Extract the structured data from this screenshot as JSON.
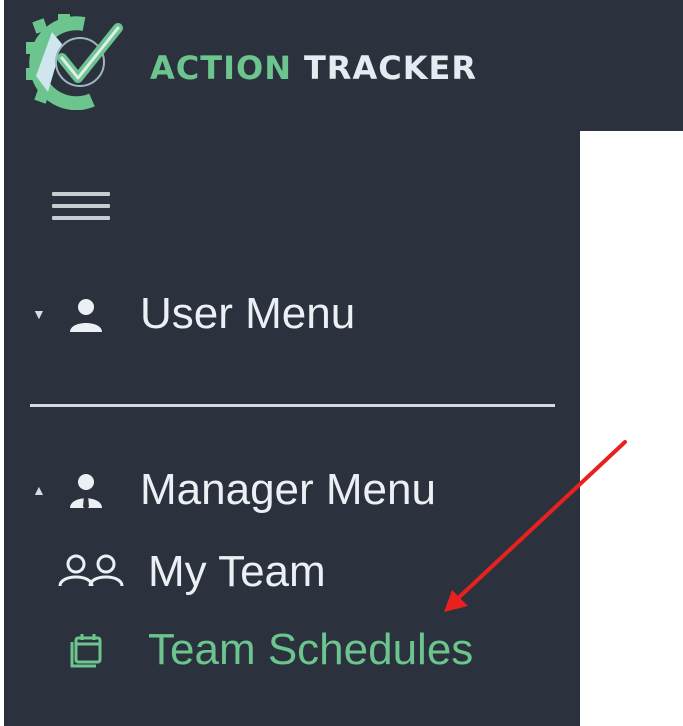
{
  "app": {
    "brand_word_1": "ACTION",
    "brand_word_2": "TRACKER"
  },
  "sidebar": {
    "toggle_icon": "hamburger-menu-icon",
    "sections": [
      {
        "label": "User Menu",
        "expanded": false,
        "icon": "user-icon"
      },
      {
        "label": "Manager Menu",
        "expanded": true,
        "icon": "manager-icon"
      }
    ],
    "items": [
      {
        "label": "My Team",
        "icon": "team-icon",
        "active": false
      },
      {
        "label": "Team Schedules",
        "icon": "calendar-icon",
        "active": true
      }
    ]
  },
  "annotation": {
    "type": "arrow",
    "color": "#e8211f",
    "points_to": "Team Schedules"
  },
  "colors": {
    "sidebar_bg": "#2b323d",
    "accent_green": "#6cc48e",
    "text_light": "#eceff3"
  }
}
